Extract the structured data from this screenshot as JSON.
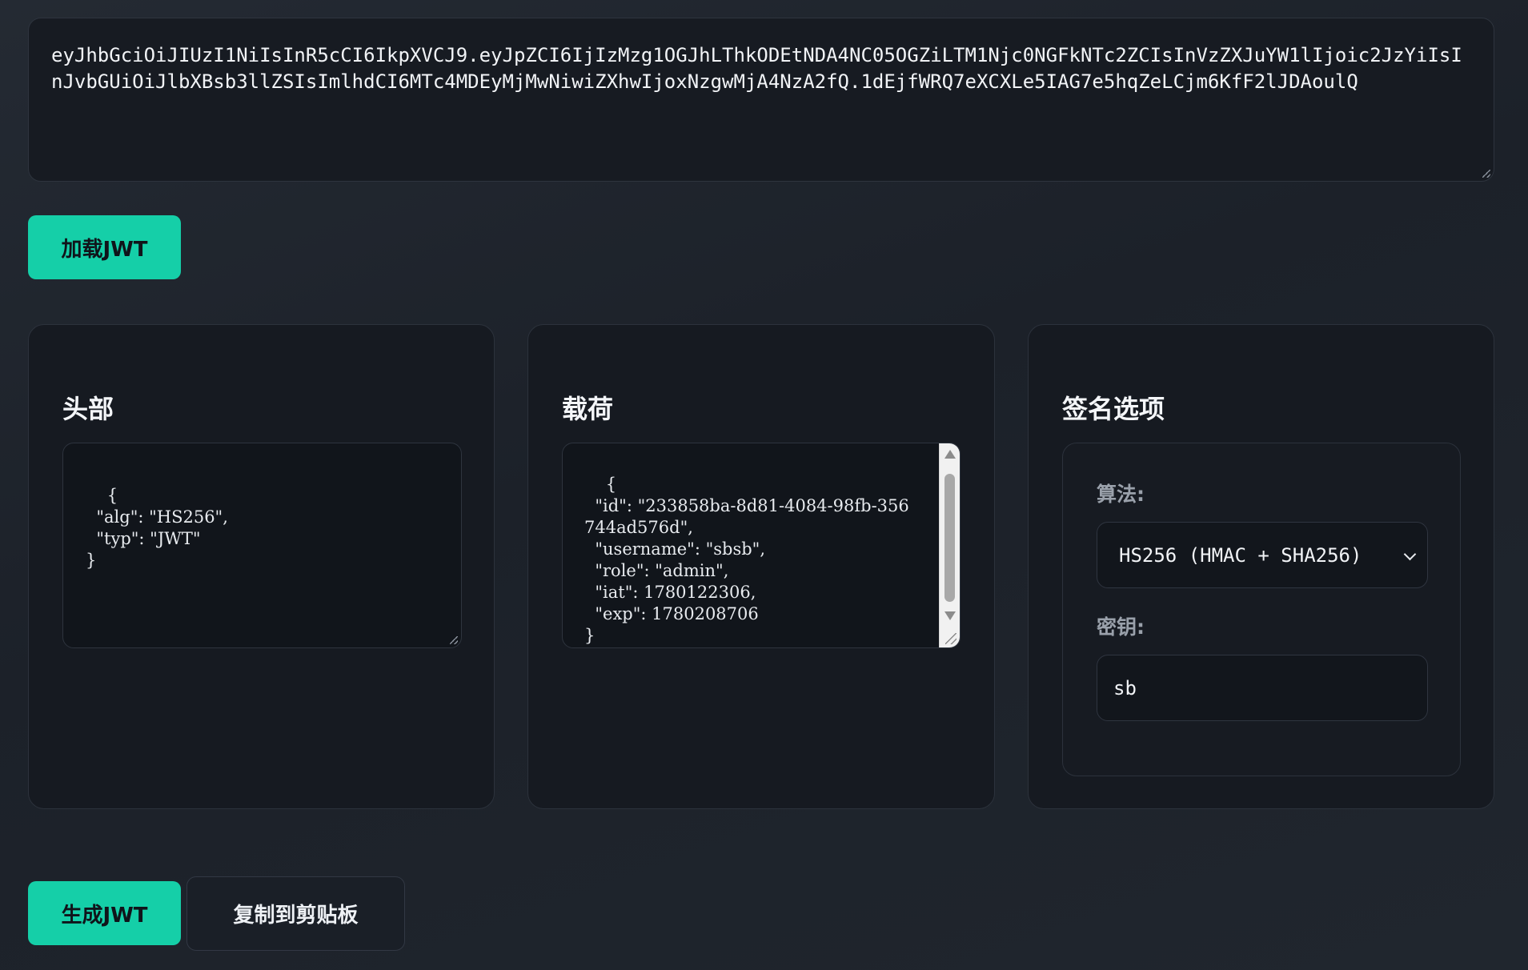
{
  "token": {
    "value": "eyJhbGciOiJIUzI1NiIsInR5cCI6IkpXVCJ9.eyJpZCI6IjIzMzg1OGJhLThkODEtNDA4NC05OGZiLTM1Njc0NGFkNTc2ZCIsInVzZXJuYW1lIjoic2JzYiIsInJvbGUiOiJlbXBsb3llZSIsImlhdCI6MTc4MDEyMjMwNiwiZXhwIjoxNzgwMjA4NzA2fQ.1dEjfWRQ7eXCXLe5IAG7e5hqZeLCjm6KfF2lJDAoulQ"
  },
  "actions": {
    "load_label": "加载JWT",
    "generate_label": "生成JWT",
    "copy_label": "复制到剪贴板"
  },
  "header_panel": {
    "title": "头部",
    "json": "{\n  \"alg\": \"HS256\",\n  \"typ\": \"JWT\"\n}"
  },
  "payload_panel": {
    "title": "载荷",
    "json": "{\n  \"id\": \"233858ba-8d81-4084-98fb-356744ad576d\",\n  \"username\": \"sbsb\",\n  \"role\": \"admin\",\n  \"iat\": 1780122306,\n  \"exp\": 1780208706\n}"
  },
  "signature_panel": {
    "title": "签名选项",
    "algorithm_label": "算法:",
    "algorithm_value": "HS256 (HMAC + SHA256)",
    "secret_label": "密钥:",
    "secret_value": "sb"
  },
  "colors": {
    "accent": "#15cfa8",
    "background": "#1c2129",
    "panel": "#161a21"
  }
}
